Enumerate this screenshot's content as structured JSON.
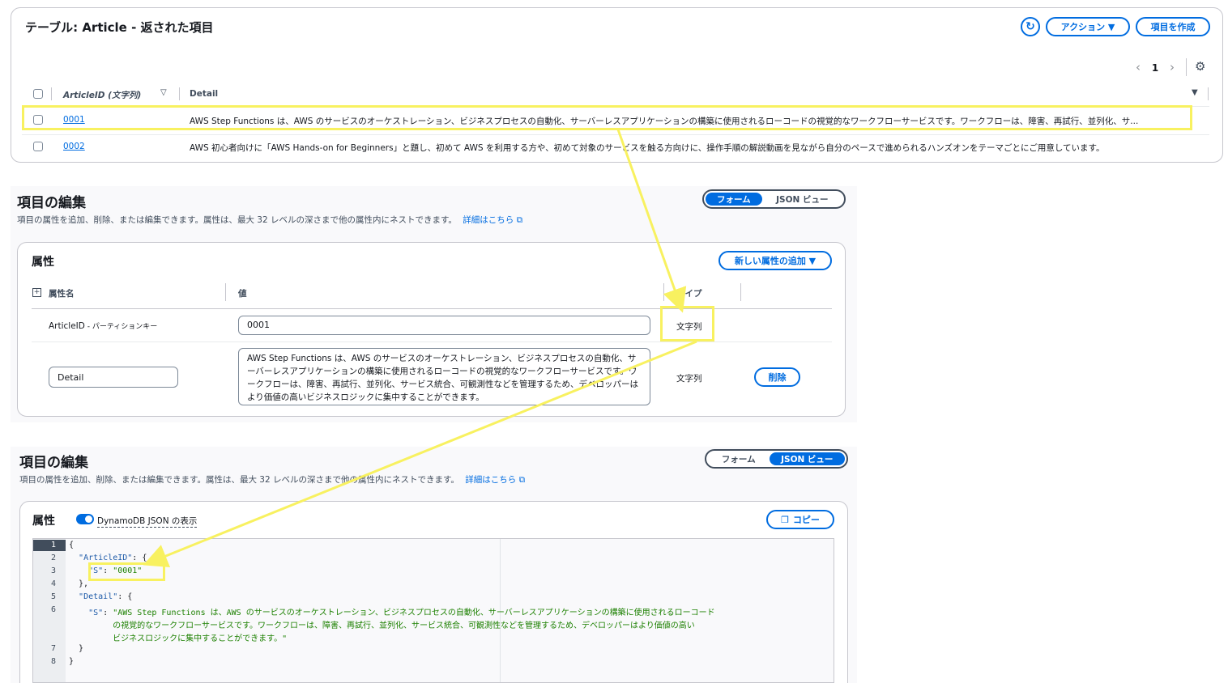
{
  "table": {
    "title": "テーブル: Article - 返された項目",
    "actions_label": "アクション ▼",
    "create_label": "項目を作成",
    "page": "1",
    "col_id": "ArticleID (文字列)",
    "col_detail": "Detail",
    "rows": [
      {
        "id": "0001",
        "detail": "AWS Step Functions は、AWS のサービスのオーケストレーション、ビジネスプロセスの自動化、サーバーレスアプリケーションの構築に使用されるローコードの視覚的なワークフローサービスです。ワークフローは、障害、再試行、並列化、サ..."
      },
      {
        "id": "0002",
        "detail": "AWS 初心者向けに「AWS Hands-on for Beginners」と題し、初めて AWS を利用する方や、初めて対象のサービスを触る方向けに、操作手順の解説動画を見ながら自分のペースで進められるハンズオンをテーマごとにご用意しています。"
      }
    ]
  },
  "form_edit": {
    "title": "項目の編集",
    "desc": "項目の属性を追加、削除、または編集できます。属性は、最大 32 レベルの深さまで他の属性内にネストできます。",
    "learn_more": "詳細はこちら",
    "tab_form": "フォーム",
    "tab_json": "JSON ビュー",
    "attr_title": "属性",
    "add_attr_label": "新しい属性の追加 ▼",
    "col_name": "属性名",
    "col_value": "値",
    "col_type": "タイプ",
    "row1_name": "ArticleID",
    "row1_suffix": " - パーティションキー",
    "row1_value": "0001",
    "row1_type": "文字列",
    "row2_name": "Detail",
    "row2_value": "AWS Step Functions は、AWS のサービスのオーケストレーション、ビジネスプロセスの自動化、サーバーレスアプリケーションの構築に使用されるローコードの視覚的なワークフローサービスです。ワークフローは、障害、再試行、並列化、サービス統合、可観測性などを管理するため、デベロッパーはより価値の高いビジネスロジックに集中することができます。",
    "row2_type": "文字列",
    "delete_label": "削除"
  },
  "json_edit": {
    "title": "項目の編集",
    "desc": "項目の属性を追加、削除、または編集できます。属性は、最大 32 レベルの深さまで他の属性内にネストできます。",
    "learn_more": "詳細はこちら",
    "tab_form": "フォーム",
    "tab_json": "JSON ビュー",
    "attr_title": "属性",
    "toggle_label": "DynamoDB JSON の表示",
    "copy_label": "コピー",
    "line_numbers": [
      "1",
      "2",
      "3",
      "4",
      "5",
      "6",
      "",
      "",
      "7",
      "8"
    ],
    "lines": [
      "{",
      "  \"ArticleID\": {",
      "    \"S\": \"0001\"",
      "  },",
      "  \"Detail\": {",
      "    \"S\": \"AWS Step Functions は、AWS のサービスのオーケストレーション、ビジネスプロセスの自動化、サーバーレスアプリケーションの構築に使用されるローコード",
      "         の視覚的なワークフローサービスです。ワークフローは、障害、再試行、並列化、サービス統合、可観測性などを管理するため、デベロッパーはより価値の高い",
      "         ビジネスロジックに集中することができます。\"",
      "  }",
      "}"
    ]
  },
  "colors": {
    "accent": "#006ce0",
    "highlight": "#f8f160",
    "border": "#c6c6cd"
  }
}
